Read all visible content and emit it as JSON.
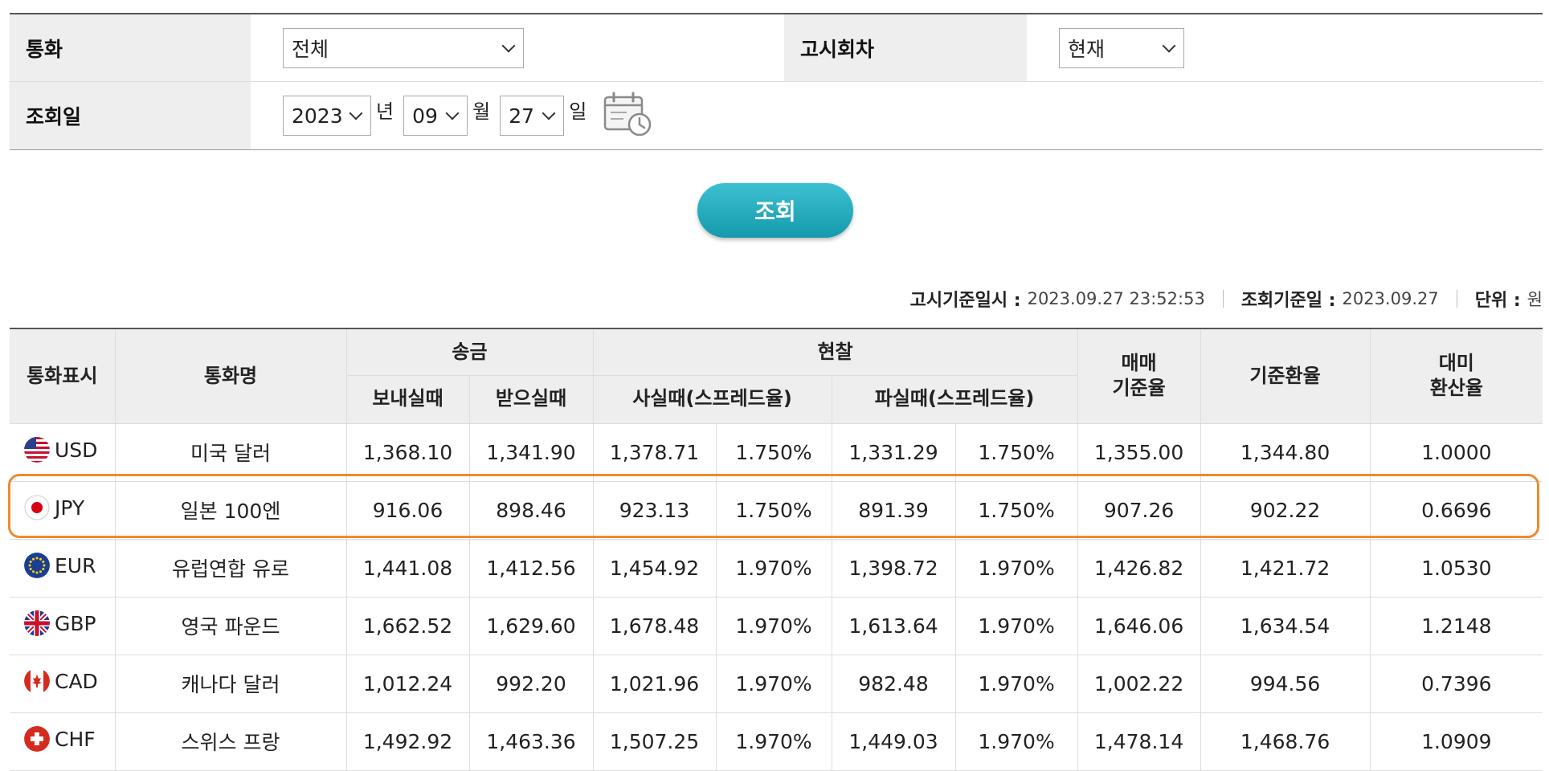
{
  "form": {
    "currency_label": "통화",
    "currency_value": "전체",
    "round_label": "고시회차",
    "round_value": "현재",
    "date_label": "조회일",
    "year": "2023",
    "year_unit": "년",
    "month": "09",
    "month_unit": "월",
    "day": "27",
    "day_unit": "일"
  },
  "search_button": "조회",
  "info": {
    "notice_label": "고시기준일시 :",
    "notice_value": "2023.09.27 23:52:53",
    "query_label": "조회기준일 :",
    "query_value": "2023.09.27",
    "unit_label": "단위 :",
    "unit_value": "원"
  },
  "table": {
    "headers": {
      "code": "통화표시",
      "name": "통화명",
      "remit": "송금",
      "remit_send": "보내실때",
      "remit_receive": "받으실때",
      "cash": "현찰",
      "cash_buy": "사실때(스프레드율)",
      "cash_sell": "파실때(스프레드율)",
      "trade_base": "매매\n기준율",
      "base_rate": "기준환율",
      "usd_ratio": "대미\n환산율"
    },
    "rows": [
      {
        "code": "USD",
        "flag": "us-flag-icon",
        "name": "미국 달러",
        "send": "1,368.10",
        "receive": "1,341.90",
        "cash_buy": "1,378.71",
        "cash_buy_spread": "1.750%",
        "cash_sell": "1,331.29",
        "cash_sell_spread": "1.750%",
        "trade_base": "1,355.00",
        "base_rate": "1,344.80",
        "usd_ratio": "1.0000"
      },
      {
        "code": "JPY",
        "flag": "jp-flag-icon",
        "name": "일본 100엔",
        "send": "916.06",
        "receive": "898.46",
        "cash_buy": "923.13",
        "cash_buy_spread": "1.750%",
        "cash_sell": "891.39",
        "cash_sell_spread": "1.750%",
        "trade_base": "907.26",
        "base_rate": "902.22",
        "usd_ratio": "0.6696"
      },
      {
        "code": "EUR",
        "flag": "eu-flag-icon",
        "name": "유럽연합 유로",
        "send": "1,441.08",
        "receive": "1,412.56",
        "cash_buy": "1,454.92",
        "cash_buy_spread": "1.970%",
        "cash_sell": "1,398.72",
        "cash_sell_spread": "1.970%",
        "trade_base": "1,426.82",
        "base_rate": "1,421.72",
        "usd_ratio": "1.0530"
      },
      {
        "code": "GBP",
        "flag": "gb-flag-icon",
        "name": "영국 파운드",
        "send": "1,662.52",
        "receive": "1,629.60",
        "cash_buy": "1,678.48",
        "cash_buy_spread": "1.970%",
        "cash_sell": "1,613.64",
        "cash_sell_spread": "1.970%",
        "trade_base": "1,646.06",
        "base_rate": "1,634.54",
        "usd_ratio": "1.2148"
      },
      {
        "code": "CAD",
        "flag": "ca-flag-icon",
        "name": "캐나다 달러",
        "send": "1,012.24",
        "receive": "992.20",
        "cash_buy": "1,021.96",
        "cash_buy_spread": "1.970%",
        "cash_sell": "982.48",
        "cash_sell_spread": "1.970%",
        "trade_base": "1,002.22",
        "base_rate": "994.56",
        "usd_ratio": "0.7396"
      },
      {
        "code": "CHF",
        "flag": "ch-flag-icon",
        "name": "스위스 프랑",
        "send": "1,492.92",
        "receive": "1,463.36",
        "cash_buy": "1,507.25",
        "cash_buy_spread": "1.970%",
        "cash_sell": "1,449.03",
        "cash_sell_spread": "1.970%",
        "trade_base": "1,478.14",
        "base_rate": "1,468.76",
        "usd_ratio": "1.0909"
      }
    ]
  },
  "colors": {
    "highlight": "#f08a2c",
    "button": "#1fa8b9",
    "header_bg": "#eeeeee"
  }
}
